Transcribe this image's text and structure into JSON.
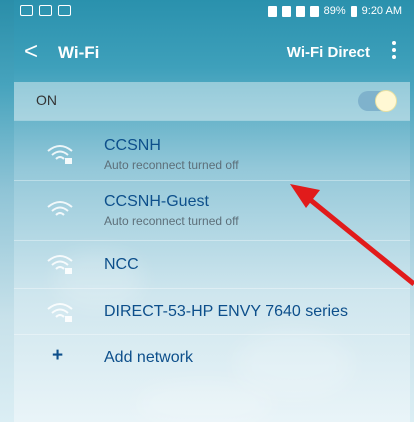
{
  "status_bar": {
    "text": "89% ▮ 9:20 AM",
    "battery": "89%",
    "time": "9:20 AM"
  },
  "titlebar": {
    "back_glyph": "<",
    "title": "Wi-Fi",
    "wifi_direct_label": "Wi-Fi Direct"
  },
  "wifi_toggle": {
    "label": "ON",
    "state": true
  },
  "networks": [
    {
      "name": "CCSNH",
      "status": "Auto reconnect turned off",
      "secured": true
    },
    {
      "name": "CCSNH-Guest",
      "status": "Auto reconnect turned off",
      "secured": false
    },
    {
      "name": "NCC",
      "status": "",
      "secured": true
    },
    {
      "name": "DIRECT-53-HP ENVY 7640 series",
      "status": "",
      "secured": true
    }
  ],
  "add_network": {
    "icon_glyph": "+",
    "label": "Add network"
  },
  "colors": {
    "accent_text": "#0d4f8b",
    "header_bg": "#2a91ad",
    "annotation_arrow": "#e11b1b"
  },
  "icons": {
    "wifi": "wifi-signal-icon",
    "lock": "lock-icon",
    "add": "plus-icon",
    "back": "back-arrow-icon",
    "more": "more-vert-icon"
  }
}
